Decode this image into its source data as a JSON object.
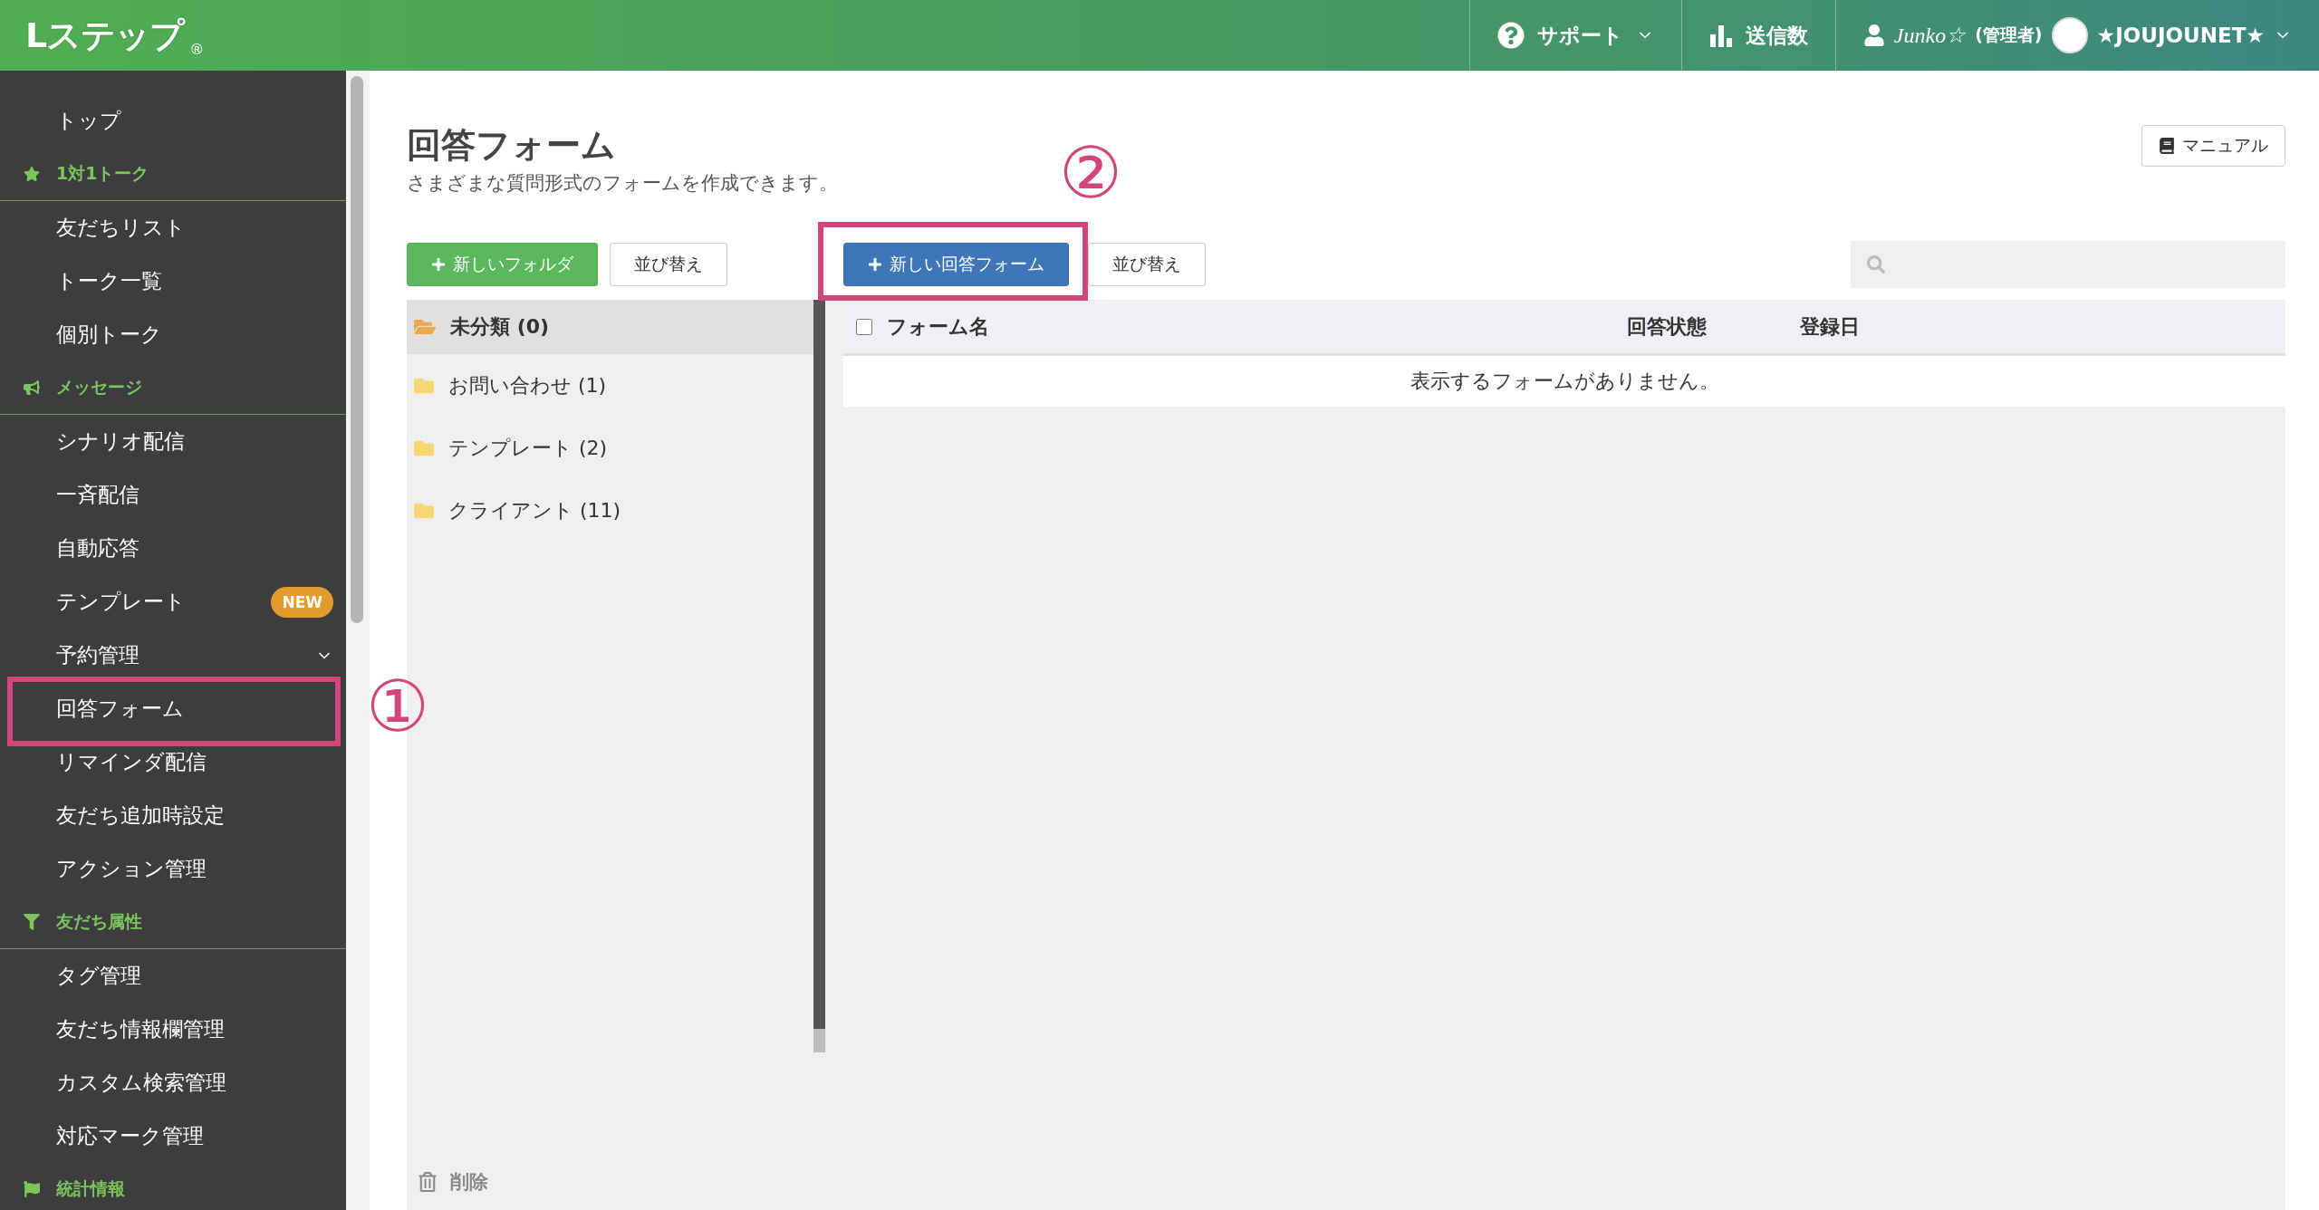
{
  "header": {
    "logo": "Lステップ",
    "logo_mark": "®",
    "nav": [
      {
        "kind": "support",
        "label": "サポート"
      },
      {
        "kind": "count",
        "label": "送信数"
      },
      {
        "kind": "user",
        "name": "Junko☆",
        "role": "(管理者)",
        "account": "★JOUJOUNET★"
      }
    ]
  },
  "sidebar": {
    "items": [
      {
        "kind": "link",
        "label": "トップ"
      },
      {
        "kind": "section",
        "label": "1対1トーク"
      },
      {
        "kind": "link",
        "label": "友だちリスト"
      },
      {
        "kind": "link",
        "label": "トーク一覧"
      },
      {
        "kind": "link",
        "label": "個別トーク"
      },
      {
        "kind": "section",
        "label": "メッセージ"
      },
      {
        "kind": "link",
        "label": "シナリオ配信"
      },
      {
        "kind": "link",
        "label": "一斉配信"
      },
      {
        "kind": "link",
        "label": "自動応答"
      },
      {
        "kind": "link",
        "label": "テンプレート",
        "badge": "NEW"
      },
      {
        "kind": "link",
        "label": "予約管理",
        "expanded": false
      },
      {
        "kind": "link",
        "label": "回答フォーム",
        "callout": "①"
      },
      {
        "kind": "link",
        "label": "リマインダ配信"
      },
      {
        "kind": "link",
        "label": "友だち追加時設定"
      },
      {
        "kind": "link",
        "label": "アクション管理"
      },
      {
        "kind": "section",
        "label": "友だち属性"
      },
      {
        "kind": "link",
        "label": "タグ管理"
      },
      {
        "kind": "link",
        "label": "友だち情報欄管理"
      },
      {
        "kind": "link",
        "label": "カスタム検索管理"
      },
      {
        "kind": "link",
        "label": "対応マーク管理"
      },
      {
        "kind": "section",
        "label": "統計情報"
      }
    ]
  },
  "page": {
    "title": "回答フォーム",
    "description": "さまざまな質問形式のフォームを作成できます。",
    "manual_button": "マニュアル"
  },
  "folder_toolbar": {
    "new_button": "新しいフォルダ",
    "sort_button": "並び替え"
  },
  "folders": [
    {
      "label": "未分類 (0)",
      "selected": true
    },
    {
      "label": "お問い合わせ (1)",
      "selected": false
    },
    {
      "label": "テンプレート (2)",
      "selected": false
    },
    {
      "label": "クライアント (11)",
      "selected": false
    }
  ],
  "delete_button": "削除",
  "form_toolbar": {
    "new_button": "新しい回答フォーム",
    "new_button_callout": "②",
    "sort_button": "並び替え"
  },
  "table": {
    "select_all_checked": false,
    "columns": [
      "フォーム名",
      "回答状態",
      "登録日"
    ],
    "empty_message": "表示するフォームがありません。"
  }
}
